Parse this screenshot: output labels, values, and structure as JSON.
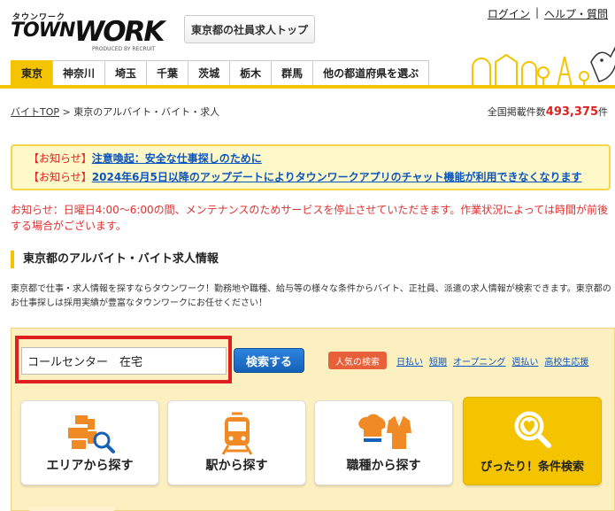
{
  "logo": {
    "kana": "タウンワーク",
    "town": "TOWN",
    "work": "WORK",
    "produced": "PRODUCED BY RECRUIT"
  },
  "header": {
    "top_button": "東京都の社員求人トップ",
    "login": "ログイン",
    "separator": "|",
    "help": "ヘルプ・質問"
  },
  "tabs": [
    "東京",
    "神奈川",
    "埼玉",
    "千葉",
    "茨城",
    "栃木",
    "群馬",
    "他の都道府県を選ぶ"
  ],
  "breadcrumb": {
    "home": "バイトTOP",
    "current": " > 東京のアルバイト・バイト・求人"
  },
  "count": {
    "prefix": "全国掲載件数",
    "value": "493,375",
    "suffix": "件"
  },
  "notices": [
    {
      "label": "【お知らせ】",
      "link": "注意喚起：安全な仕事探しのために"
    },
    {
      "label": "【お知らせ】",
      "link": "2024年6月5日以降のアップデートによりタウンワークアプリのチャット機能が利用できなくなります"
    }
  ],
  "maintenance": "お知らせ：日曜日4:00～6:00の間、メンテナンスのためサービスを停止させていただきます。作業状況によっては時間が前後する場合がございます。",
  "section_title": "東京都のアルバイト・バイト求人情報",
  "description": "東京都で仕事・求人情報を探すならタウンワーク！勤務地や職種、給与等の様々な条件からバイト、正社員、派遣の求人情報が検索できます。東京都のお仕事探しは採用実績が豊富なタウンワークにお任せください！",
  "search": {
    "value": "コールセンター　在宅",
    "button": "検索する",
    "popular_label": "人気の検索",
    "popular_links": [
      "日払い",
      "短期",
      "オープニング",
      "週払い",
      "高校生応援"
    ]
  },
  "cards": [
    {
      "label": "エリアから探す",
      "icon": "map-icon"
    },
    {
      "label": "駅から探す",
      "icon": "train-icon"
    },
    {
      "label": "職種から探す",
      "icon": "job-icon"
    },
    {
      "label": "ぴったり！条件検索",
      "icon": "heart-search-icon"
    }
  ],
  "colors": {
    "brand_yellow": "#f5c400",
    "accent_red": "#e02020",
    "link_blue": "#0a55c0",
    "button_blue": "#1660b8"
  }
}
